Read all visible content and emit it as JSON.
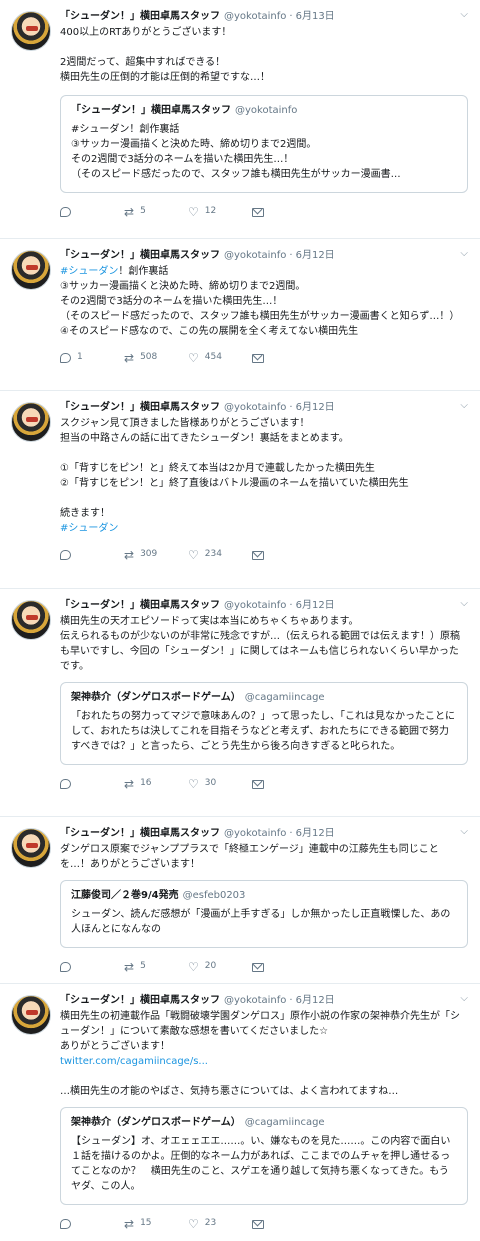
{
  "tweets": [
    {
      "name": "「シューダン！」横田卓馬スタッフ",
      "handle": "@yokotainfo",
      "time": "6月13日",
      "text": "400以上のRTありがとうございます！\n\n2週間だって、超集中すればできる！\n横田先生の圧倒的才能は圧倒的希望ですな…！",
      "quote": {
        "name": "「シューダン！」横田卓馬スタッフ",
        "handle": "@yokotainfo",
        "text": "#シューダン！創作裏話\n③サッカー漫画描くと決めた時、締め切りまで2週間。\nその2週間で3話分のネームを描いた横田先生…！\n（そのスピード感だったので、スタッフ誰も横田先生がサッカー漫画書…"
      },
      "replies": "",
      "retweets": "5",
      "likes": "12"
    },
    {
      "name": "「シューダン！」横田卓馬スタッフ",
      "handle": "@yokotainfo",
      "time": "6月12日",
      "hashtag": "#シューダン",
      "text_after_tag": "！創作裏話\n③サッカー漫画描くと決めた時、締め切りまで2週間。\nその2週間で3話分のネームを描いた横田先生…！\n（そのスピード感だったので、スタッフ誰も横田先生がサッカー漫画書くと知らず…！）\n④そのスピード感なので、この先の展開を全く考えてない横田先生",
      "replies": "1",
      "retweets": "508",
      "likes": "454"
    },
    {
      "name": "「シューダン！」横田卓馬スタッフ",
      "handle": "@yokotainfo",
      "time": "6月12日",
      "text": "スクジャン見て頂きました皆様ありがとうございます！\n担当の中路さんの話に出てきたシューダン！裏話をまとめます。\n\n①「背すじをピン！と」終えて本当は2か月で連載したかった横田先生\n②「背すじをピン！と」終了直後はバトル漫画のネームを描いていた横田先生\n\n続きます！\n",
      "hashtag": "#シューダン",
      "replies": "",
      "retweets": "309",
      "likes": "234"
    },
    {
      "name": "「シューダン！」横田卓馬スタッフ",
      "handle": "@yokotainfo",
      "time": "6月12日",
      "text": "横田先生の天才エピソードって実は本当にめちゃくちゃあります。\n伝えられるものが少ないのが非常に残念ですが…（伝えられる範囲では伝えます！）原稿も早いですし、今回の「シューダン！」に関してはネームも信じられないくらい早かったです。",
      "quote": {
        "name": "架神恭介（ダンゲロスボードゲーム）",
        "handle": "@cagamiincage",
        "text": "「おれたちの努力ってマジで意味あんの？」って思ったし、「これは見なかったことにして、おれたちは決してこれを目指そうなどと考えず、おれたちにできる範囲で努力すべきでは？」と言ったら、ごとう先生から後ろ向きすぎると叱られた。"
      },
      "replies": "",
      "retweets": "16",
      "likes": "30"
    },
    {
      "name": "「シューダン！」横田卓馬スタッフ",
      "handle": "@yokotainfo",
      "time": "6月12日",
      "text": "ダンゲロス原案でジャンププラスで「終極エンゲージ」連載中の江藤先生も同じことを…！ありがとうございます！",
      "quote": {
        "name": "江藤俊司／２巻9/4発売",
        "handle": "@esfeb0203",
        "text": "シューダン、読んだ感想が「漫画が上手すぎる」しか無かったし正直戦慄した、あの人ほんとになんなの"
      },
      "replies": "",
      "retweets": "5",
      "likes": "20"
    },
    {
      "name": "「シューダン！」横田卓馬スタッフ",
      "handle": "@yokotainfo",
      "time": "6月12日",
      "text": "横田先生の初連載作品「戦闘破壊学園ダンゲロス」原作小説の作家の架神恭介先生が「シューダン！」について素敵な感想を書いてくださいました☆\nありがとうございます！",
      "link": "twitter.com/cagamiincage/s...",
      "text2": "…横田先生の才能のやばさ、気持ち悪さについては、よく言われてますね…",
      "quote": {
        "name": "架神恭介（ダンゲロスボードゲーム）",
        "handle": "@cagamiincage",
        "text": "【シューダン】オ、オエェェエエ……。い、嫌なものを見た……。この内容で面白い１話を描けるのかよ。圧倒的なネーム力があれば、ここまでのムチャを押し通せるってことなのか？　横田先生のこと、スゲエを通り越して気持ち悪くなってきた。もうヤダ、この人。"
      },
      "replies": "",
      "retweets": "15",
      "likes": "23"
    }
  ],
  "icons": {
    "reply": "reply-icon",
    "retweet": "retweet-icon",
    "like": "heart-icon",
    "dm": "envelope-icon",
    "caret": "chevron-down-icon"
  }
}
